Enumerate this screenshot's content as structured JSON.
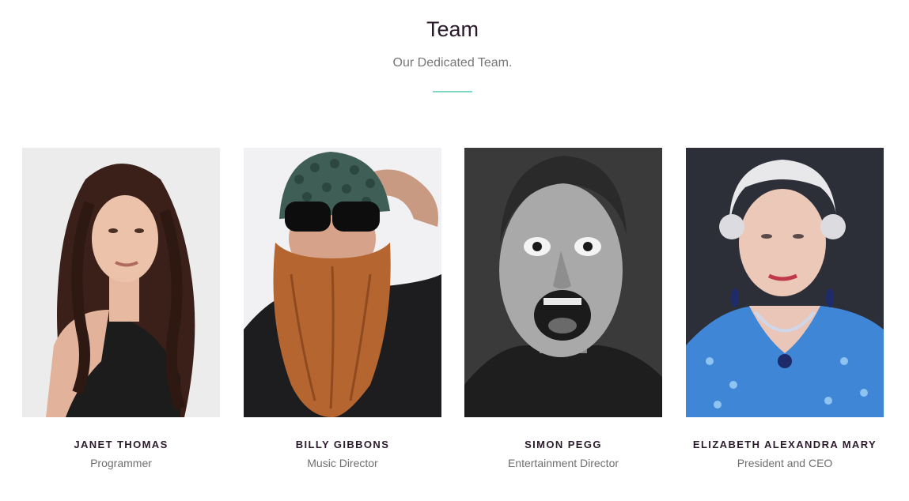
{
  "header": {
    "title": "Team",
    "subtitle": "Our Dedicated Team.",
    "accent_color": "#7fd7c6"
  },
  "members": [
    {
      "name": "JANET THOMAS",
      "role": "Programmer",
      "photo_icon": "portrait-woman-long-dark-hair"
    },
    {
      "name": "BILLY GIBBONS",
      "role": "Music Director",
      "photo_icon": "portrait-man-beard-sunglasses-beanie"
    },
    {
      "name": "SIMON PEGG",
      "role": "Entertainment Director",
      "photo_icon": "portrait-man-screaming-bw"
    },
    {
      "name": "ELIZABETH ALEXANDRA MARY",
      "role": "President and CEO",
      "photo_icon": "portrait-elderly-woman-blue-dress"
    }
  ]
}
